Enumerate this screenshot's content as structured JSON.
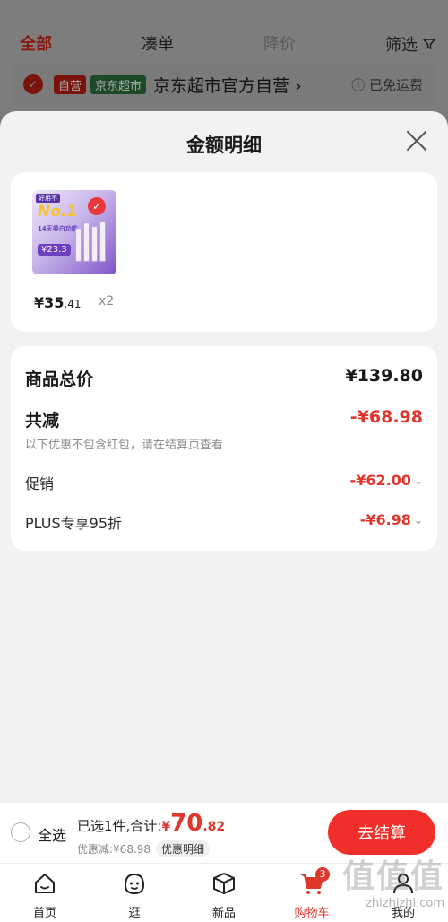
{
  "background": {
    "tabs": [
      {
        "label": "全部",
        "active": true
      },
      {
        "label": "凑单",
        "active": false
      },
      {
        "label": "降价",
        "active": false,
        "muted": true
      }
    ],
    "filter_label": "筛选",
    "store": {
      "badge_self": "自营",
      "badge_market": "京东超市",
      "name": "京东超市官方自营 ›",
      "shipping": "ⓘ 已免运费"
    }
  },
  "sheet": {
    "title": "金额明细",
    "product": {
      "thumb_tag": "好用不",
      "thumb_no1": "No.1",
      "thumb_line": "14天美白功能",
      "thumb_price": "¥23.3",
      "unit_price_int": "¥35",
      "unit_price_dec": ".41",
      "quantity": "x2"
    },
    "detail": {
      "total_label": "商品总价",
      "total_value": "¥139.80",
      "reduce_label": "共减",
      "reduce_value": "-¥68.98",
      "note": "以下优惠不包含红包，请在结算页查看",
      "promo_label": "促销",
      "promo_value": "-¥62.00",
      "plus_label": "PLUS专享95折",
      "plus_value": "-¥6.98"
    }
  },
  "checkout": {
    "select_all": "全选",
    "selected_text": "已选1件,合计:",
    "total_yen": "¥",
    "total_int": "70",
    "total_dec": ".82",
    "discount_text": "优惠减:¥68.98",
    "discount_btn": "优惠明细",
    "pay_btn": "去结算"
  },
  "tabbar": {
    "items": [
      {
        "label": "首页",
        "icon": "home-icon"
      },
      {
        "label": "逛",
        "icon": "face-icon"
      },
      {
        "label": "新品",
        "icon": "box-icon"
      },
      {
        "label": "购物车",
        "icon": "cart-icon",
        "active": true,
        "badge": "3"
      },
      {
        "label": "我的",
        "icon": "user-icon"
      }
    ]
  },
  "watermark": {
    "big": "值值值",
    "small": "zhizhizhi.com"
  }
}
